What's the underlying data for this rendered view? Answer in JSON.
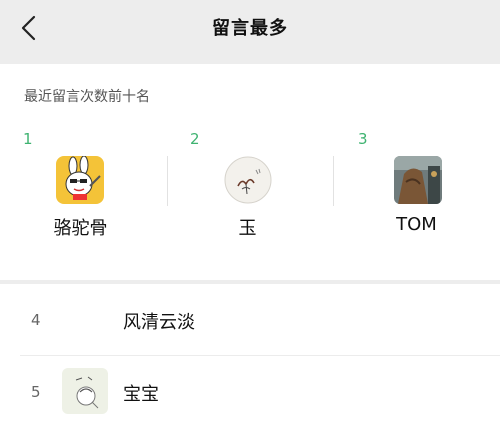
{
  "navbar": {
    "back_icon": "chevron-left-icon",
    "title": "留言最多"
  },
  "section_label": "最近留言次数前十名",
  "top3": [
    {
      "rank": "1",
      "name": "骆驼骨",
      "avatar": "cartoon-rabbit-avatar"
    },
    {
      "rank": "2",
      "name": "玉",
      "avatar": "ink-flower-avatar"
    },
    {
      "rank": "3",
      "name": "TOM",
      "avatar": "photo-avatar"
    }
  ],
  "list": [
    {
      "rank": "4",
      "name": "风清云淡"
    },
    {
      "rank": "5",
      "name": "宝宝",
      "avatar": "sketch-avatar"
    }
  ],
  "colors": {
    "rank_accent": "#3fb371",
    "background": "#ededed",
    "panel": "#ffffff"
  }
}
